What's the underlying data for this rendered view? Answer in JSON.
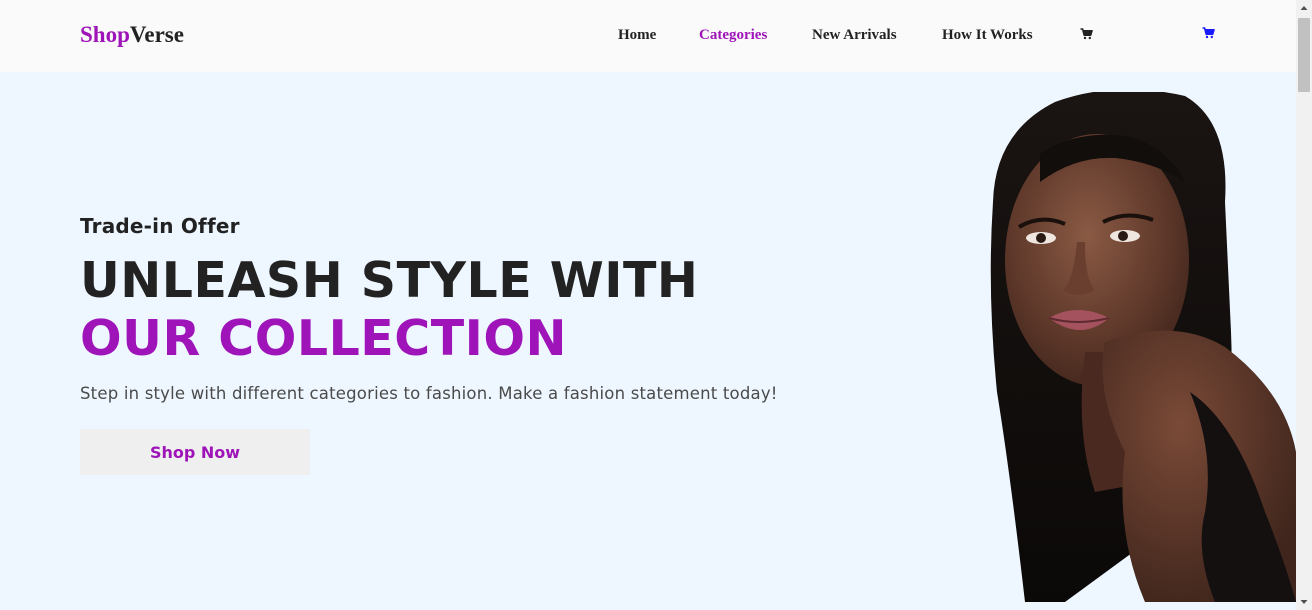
{
  "brand": {
    "first": "Shop",
    "second": "Verse"
  },
  "nav": {
    "items": [
      {
        "label": "Home",
        "active": false
      },
      {
        "label": "Categories",
        "active": true
      },
      {
        "label": "New Arrivals",
        "active": false
      },
      {
        "label": "How It Works",
        "active": false
      }
    ],
    "icons": [
      "cart-icon",
      "cart-icon"
    ]
  },
  "hero": {
    "eyebrow": "Trade-in Offer",
    "headline_line1": "UNLEASH STYLE WITH",
    "headline_line2": "OUR COLLECTION",
    "tagline": "Step in style with different categories to fashion. Make a fashion statement today!",
    "cta_label": "Shop Now"
  },
  "colors": {
    "accent": "#9e14b8",
    "hero_background": "#eef7ff",
    "navbar_background": "#fafafa",
    "text_dark": "#222222",
    "button_background": "#efefef"
  }
}
